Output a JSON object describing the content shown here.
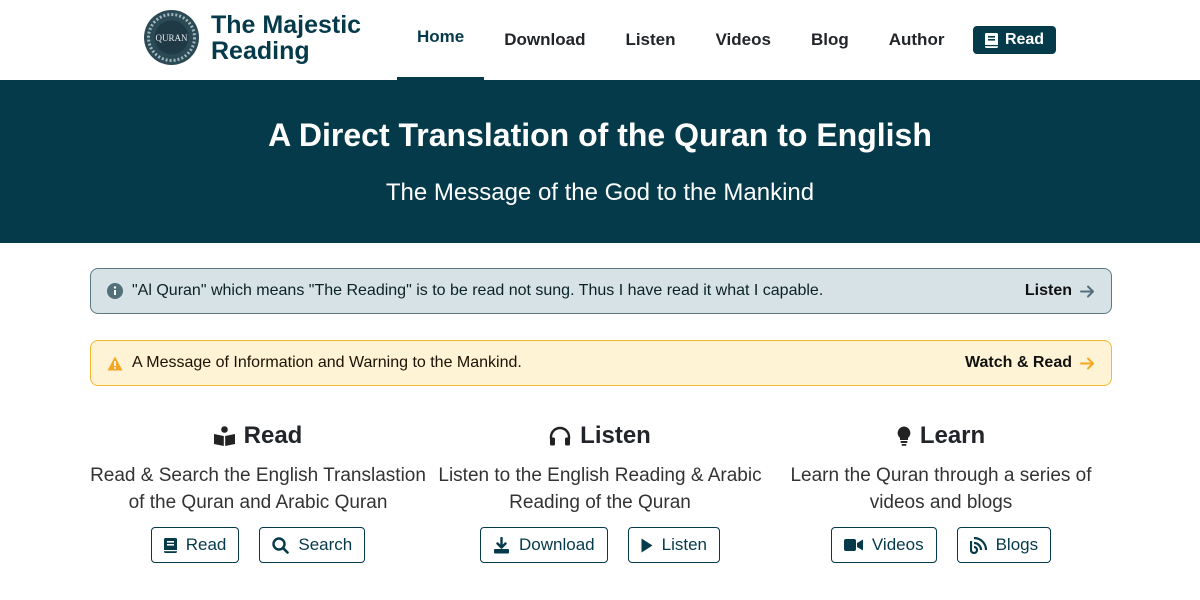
{
  "brand": {
    "logo_text": "QURAN",
    "name_line1": "The Majestic",
    "name_line2": "Reading"
  },
  "nav": {
    "items": [
      {
        "label": "Home",
        "active": true
      },
      {
        "label": "Download"
      },
      {
        "label": "Listen"
      },
      {
        "label": "Videos"
      },
      {
        "label": "Blog"
      },
      {
        "label": "Author"
      }
    ],
    "read_button": "Read"
  },
  "hero": {
    "title": "A Direct Translation of the Quran to English",
    "subtitle": "The Message of the God to the Mankind"
  },
  "alerts": {
    "info": {
      "text": "\"Al Quran\" which means \"The Reading\" is to be read not sung. Thus I have read it what I capable.",
      "link": "Listen",
      "icon": "info-icon"
    },
    "warning": {
      "text": "A Message of Information and Warning to the Mankind.",
      "link": "Watch & Read",
      "icon": "warning-icon"
    }
  },
  "features": {
    "read": {
      "title": "Read",
      "icon": "book-reader-icon",
      "description": "Read & Search the English Translastion of the Quran and Arabic Quran",
      "buttons": [
        "Read",
        "Search"
      ]
    },
    "listen": {
      "title": "Listen",
      "icon": "headphones-icon",
      "description": "Listen to the English Reading & Arabic Reading of the Quran",
      "buttons": [
        "Download",
        "Listen"
      ]
    },
    "learn": {
      "title": "Learn",
      "icon": "lightbulb-icon",
      "description": "Learn the Quran through a series of videos and blogs",
      "buttons": [
        "Videos",
        "Blogs"
      ]
    }
  },
  "colors": {
    "primary": "#053a4a",
    "info_bg": "#d6e2e6",
    "warning_bg": "#fff3d6",
    "warning_accent": "#f5a623"
  }
}
